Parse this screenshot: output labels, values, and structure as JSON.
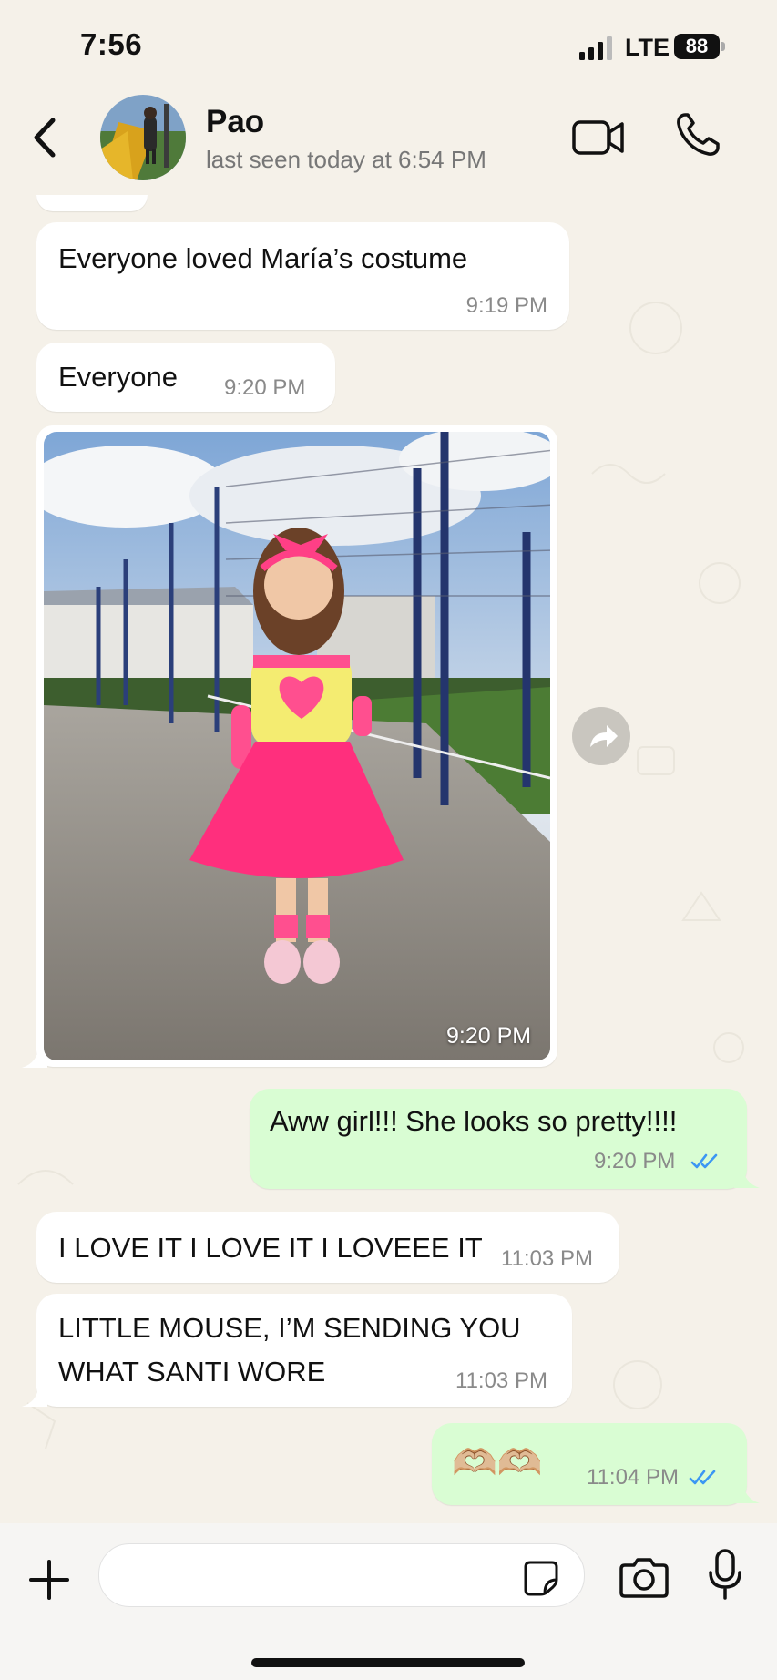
{
  "status_bar": {
    "time": "7:56",
    "network": "LTE",
    "battery": "88"
  },
  "header": {
    "contact_name": "Pao",
    "last_seen": "last seen today at 6:54 PM",
    "back_icon": "chevron-left-icon",
    "video_icon": "video-camera-icon",
    "phone_icon": "phone-icon"
  },
  "colors": {
    "chat_background": "#f5f1e9",
    "incoming_bubble": "#ffffff",
    "outgoing_bubble": "#d9fdd3",
    "read_ticks": "#3b97f3"
  },
  "messages": [
    {
      "direction": "in",
      "text": "Everyone loved María’s costume",
      "time": "9:19 PM"
    },
    {
      "direction": "in",
      "text": "Everyone",
      "time": "9:20 PM"
    },
    {
      "direction": "in",
      "type": "image",
      "time": "9:20 PM"
    },
    {
      "direction": "out",
      "text": "Aww girl!!! She looks so pretty!!!!",
      "time": "9:20 PM",
      "status": "read"
    },
    {
      "direction": "in",
      "text": "I LOVE IT I LOVE IT I LOVEEE IT",
      "time": "11:03 PM"
    },
    {
      "direction": "in",
      "text_lines": [
        "LITTLE MOUSE, I’M SENDING YOU",
        "WHAT SANTI WORE"
      ],
      "time": "11:03 PM"
    },
    {
      "direction": "out",
      "text": "🫶🏼🫶🏼",
      "time": "11:04 PM",
      "status": "read"
    }
  ],
  "input_bar": {
    "plus_icon": "plus-icon",
    "sticker_icon": "sticker-icon",
    "camera_icon": "camera-icon",
    "mic_icon": "microphone-icon"
  }
}
